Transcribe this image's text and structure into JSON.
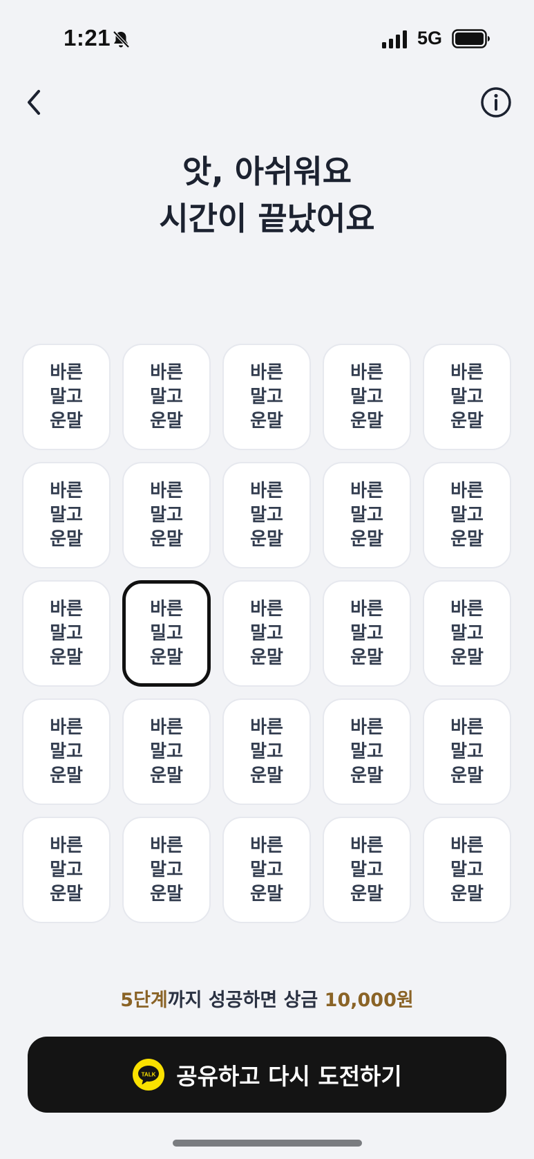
{
  "status_bar": {
    "time": "1:21",
    "network": "5G",
    "icons": [
      "bell-slash-icon",
      "signal-icon",
      "battery-icon"
    ]
  },
  "nav": {
    "back_icon": "chevron-left-icon",
    "info_icon": "info-circle-icon"
  },
  "title": {
    "line1": "앗, 아쉬워요",
    "line2": "시간이 끝났어요"
  },
  "grid": {
    "rows": [
      [
        "바른\n말고\n운말",
        "바른\n말고\n운말",
        "바른\n말고\n운말",
        "바른\n말고\n운말",
        "바른\n말고\n운말"
      ],
      [
        "바른\n말고\n운말",
        "바른\n말고\n운말",
        "바른\n말고\n운말",
        "바른\n말고\n운말",
        "바른\n말고\n운말"
      ],
      [
        "바른\n말고\n운말",
        "바른\n밀고\n운말",
        "바른\n말고\n운말",
        "바른\n말고\n운말",
        "바른\n말고\n운말"
      ],
      [
        "바른\n말고\n운말",
        "바른\n말고\n운말",
        "바른\n말고\n운말",
        "바른\n말고\n운말",
        "바른\n말고\n운말"
      ],
      [
        "바른\n말고\n운말",
        "바른\n말고\n운말",
        "바른\n말고\n운말",
        "바른\n말고\n운말",
        "바른\n말고\n운말"
      ]
    ],
    "selected": {
      "row": 2,
      "col": 1
    }
  },
  "prize": {
    "level": "5단계",
    "middle": "까지 성공하면 상금 ",
    "amount": "10,000원"
  },
  "cta": {
    "label": "공유하고 다시 도전하기",
    "icon": "kakaotalk-icon",
    "icon_text": "TALK"
  },
  "colors": {
    "background": "#f2f3f6",
    "tile": "#ffffff",
    "tile_border": "#e6e8ee",
    "selected_border": "#111111",
    "accent": "#8a6326",
    "cta_background": "#141414",
    "kakao_yellow": "#fae100"
  }
}
